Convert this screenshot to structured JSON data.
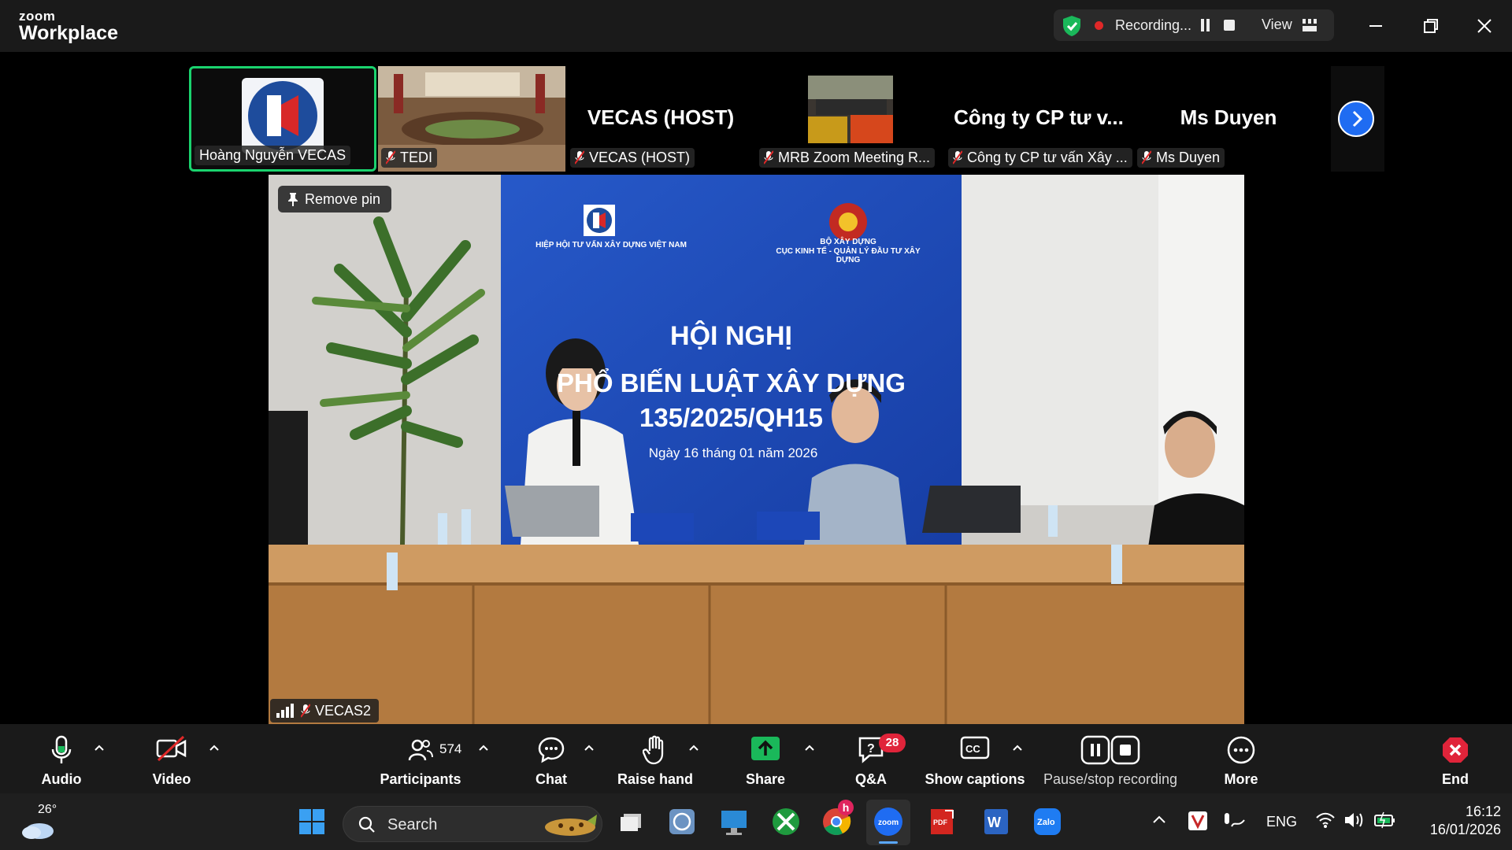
{
  "app": {
    "brand_small": "zoom",
    "brand_big": "Workplace"
  },
  "titlebar": {
    "recording_label": "Recording...",
    "view_label": "View"
  },
  "thumbnails": [
    {
      "big_name": "",
      "name": "Hoàng Nguyễn VECAS",
      "muted": false
    },
    {
      "big_name": "",
      "name": "TEDI",
      "muted": true
    },
    {
      "big_name": "VECAS (HOST)",
      "name": "VECAS (HOST)",
      "muted": true
    },
    {
      "big_name": "",
      "name": "MRB Zoom Meeting R...",
      "muted": true
    },
    {
      "big_name": "Công ty CP tư v...",
      "name": "Công ty CP tư vấn Xây ...",
      "muted": true
    },
    {
      "big_name": "Ms Duyen",
      "name": "Ms Duyen",
      "muted": true
    }
  ],
  "main_video": {
    "pin_label": "Remove pin",
    "speaker_name": "VECAS2",
    "banner": {
      "left_org": "HIỆP HỘI TƯ VẤN XÂY DỰNG VIỆT NAM",
      "right_org_1": "BỘ XÂY DỰNG",
      "right_org_2": "CỤC KINH TẾ - QUẢN LÝ ĐẦU TƯ XÂY DỰNG",
      "title_1": "HỘI NGHỊ",
      "title_2": "PHỔ BIẾN LUẬT XÂY DỰNG",
      "title_3": "135/2025/QH15",
      "date": "Ngày 16 tháng 01 năm 2026"
    }
  },
  "toolbar": {
    "audio": "Audio",
    "video": "Video",
    "participants": "Participants",
    "participants_count": "574",
    "chat": "Chat",
    "raise_hand": "Raise hand",
    "share": "Share",
    "qa": "Q&A",
    "qa_badge": "28",
    "captions": "Show captions",
    "recording": "Pause/stop recording",
    "more": "More",
    "end": "End"
  },
  "taskbar": {
    "weather_temp": "26°",
    "search_placeholder": "Search",
    "chrome_badge": "h",
    "language": "ENG",
    "time": "16:12",
    "date": "16/01/2026"
  },
  "colors": {
    "titlebar_bg": "#1a1a1a",
    "active_speaker_border": "#1ad36e",
    "share_green": "#1ab85a",
    "badge_red": "#e0243a",
    "end_red": "#e0243a",
    "next_button_blue": "#1f6cf2",
    "banner_blue": "#1c47b8"
  }
}
